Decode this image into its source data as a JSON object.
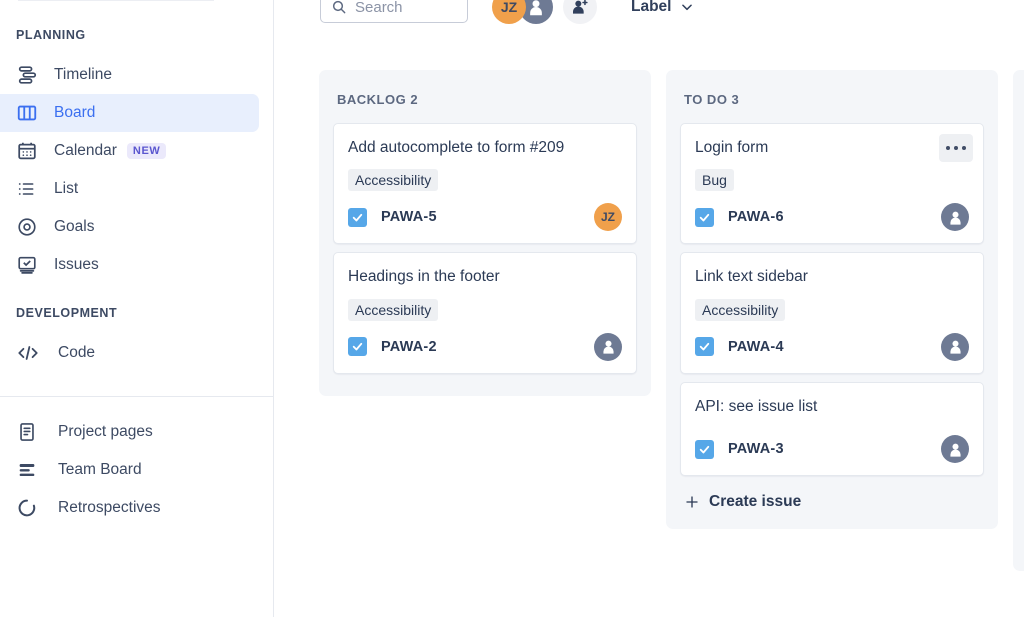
{
  "sidebar": {
    "sections": [
      {
        "label": "PLANNING",
        "items": [
          {
            "label": "Timeline",
            "icon": "timeline-icon",
            "active": false
          },
          {
            "label": "Board",
            "icon": "board-icon",
            "active": true
          },
          {
            "label": "Calendar",
            "icon": "calendar-icon",
            "active": false,
            "badge": "NEW"
          },
          {
            "label": "List",
            "icon": "list-icon",
            "active": false
          },
          {
            "label": "Goals",
            "icon": "goals-icon",
            "active": false
          },
          {
            "label": "Issues",
            "icon": "issues-icon",
            "active": false
          }
        ]
      },
      {
        "label": "DEVELOPMENT",
        "items": [
          {
            "label": "Code",
            "icon": "code-icon",
            "active": false
          }
        ]
      }
    ],
    "footer_items": [
      {
        "label": "Project pages",
        "icon": "page-icon"
      },
      {
        "label": "Team Board",
        "icon": "team-board-icon"
      },
      {
        "label": "Retrospectives",
        "icon": "retrospectives-icon"
      }
    ]
  },
  "toolbar": {
    "search_placeholder": "Search",
    "avatars": [
      {
        "initials": "JZ",
        "type": "initials"
      },
      {
        "initials": "",
        "type": "anonymous"
      }
    ],
    "add_people_label": "",
    "label_filter": "Label"
  },
  "board": {
    "columns": [
      {
        "name": "BACKLOG",
        "count": "2",
        "header": "BACKLOG 2",
        "cards": [
          {
            "title": "Add autocomplete to form #209",
            "tag": "Accessibility",
            "key": "PAWA-5",
            "avatar": "JZ",
            "avatar_type": "initials",
            "has_more": false
          },
          {
            "title": "Headings in the footer",
            "tag": "Accessibility",
            "key": "PAWA-2",
            "avatar": "",
            "avatar_type": "anonymous",
            "has_more": false
          }
        ],
        "create_issue": ""
      },
      {
        "name": "TO DO",
        "count": "3",
        "header": "TO DO 3",
        "cards": [
          {
            "title": "Login form",
            "tag": "Bug",
            "key": "PAWA-6",
            "avatar": "",
            "avatar_type": "anonymous",
            "has_more": true
          },
          {
            "title": "Link text sidebar",
            "tag": "Accessibility",
            "key": "PAWA-4",
            "avatar": "",
            "avatar_type": "anonymous",
            "has_more": false
          },
          {
            "title": "API: see issue list",
            "tag": "",
            "key": "PAWA-3",
            "avatar": "",
            "avatar_type": "anonymous",
            "has_more": false
          }
        ],
        "create_issue": "Create issue"
      }
    ]
  },
  "colors": {
    "accent_blue": "#3b6ff0",
    "active_bg": "#e8effd",
    "badge_new_bg": "#ebe9fb",
    "badge_new_text": "#5b57cf",
    "column_bg": "#f4f6f9",
    "checkbox_blue": "#56a7e8",
    "avatar_orange": "#f0a04b",
    "avatar_gray": "#6e7a94",
    "text_primary": "#2b3a55"
  }
}
